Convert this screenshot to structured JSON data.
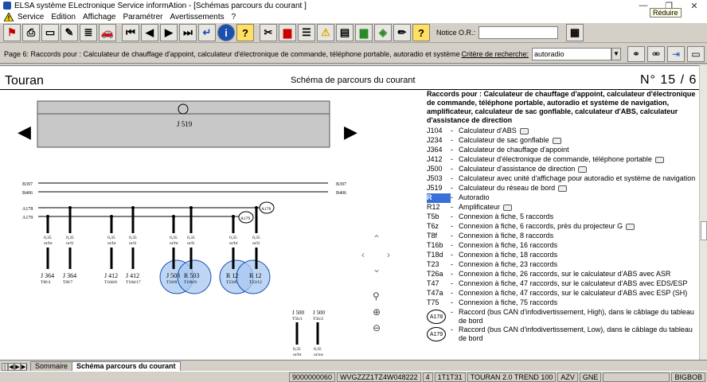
{
  "window": {
    "title": "ELSA système ELectronique Service informAtion - [Schémas parcours du courant ]",
    "tooltip": "Réduire"
  },
  "menu": {
    "items": [
      "Service",
      "Edition",
      "Affichage",
      "Paramétrer",
      "Avertissements",
      "?"
    ]
  },
  "toolbar": {
    "notice_label": "Notice O.R.:",
    "notice_value": ""
  },
  "infobar": {
    "path": "Page 6: Raccords pour : Calculateur de chauffage d'appoint, calculateur d'électronique de commande, téléphone portable, autoradio et système de navigation,",
    "search_label": "Critère de recherche:",
    "search_value": "autoradio"
  },
  "document": {
    "model": "Touran",
    "title": "Schéma de parcours du courant",
    "page": "N°  15 / 6"
  },
  "schematic": {
    "module_label": "J 519",
    "rails": {
      "b397": "B397",
      "b406": "B406",
      "a178": "A178",
      "a179": "A179"
    },
    "wires": [
      {
        "size": "0,35",
        "color": "or/br",
        "comp": "J 364",
        "pin": "T8f/4"
      },
      {
        "size": "0,35",
        "color": "or/li",
        "comp": "J 364",
        "pin": "T8f/7"
      },
      {
        "size": "0,35",
        "color": "or/br",
        "comp": "J 412",
        "pin": "T18d/8"
      },
      {
        "size": "0,35",
        "color": "or/li",
        "comp": "J 412",
        "pin": "T18d/17"
      },
      {
        "size": "0,35",
        "color": "or/br",
        "comp": "J 503",
        "pin": "T18/8"
      },
      {
        "size": "0,35",
        "color": "or/li",
        "comp": "R 503",
        "pin": "T18b/9"
      },
      {
        "size": "0,35",
        "color": "or/br",
        "comp": "R 12",
        "pin": "T23/8"
      },
      {
        "size": "0,35",
        "color": "or/li",
        "comp": "R 12",
        "pin": "T23/12"
      }
    ],
    "lower_wires": [
      {
        "size": "0,35",
        "color": "or/br",
        "comp": "J 500",
        "pin": "T5b/1"
      },
      {
        "size": "0,35",
        "color": "or/sw",
        "comp": "J 500",
        "pin": "T5b/2"
      }
    ]
  },
  "legend": {
    "heading": "Raccords pour : Calculateur de chauffage d'appoint, calculateur d'électronique de commande, téléphone portable, autoradio et système de navigation, amplificateur, calculateur de sac gonflable, calculateur d'ABS, calculateur d'assistance de direction",
    "rows": [
      {
        "code": "J104",
        "desc": "Calculateur d'ABS",
        "cam": true
      },
      {
        "code": "J234",
        "desc": "Calculateur de sac gonflable",
        "cam": true
      },
      {
        "code": "J364",
        "desc": "Calculateur de chauffage d'appoint",
        "cam": false
      },
      {
        "code": "J412",
        "desc": "Calculateur d'électronique de commande, téléphone portable",
        "cam": true
      },
      {
        "code": "J500",
        "desc": "Calculateur d'assistance de direction",
        "cam": true
      },
      {
        "code": "J503",
        "desc": "Calculateur avec unité d'affichage pour autoradio et système de navigation",
        "cam": false
      },
      {
        "code": "J519",
        "desc": "Calculateur du réseau de bord",
        "cam": true
      },
      {
        "code": "R",
        "desc": "Autoradio",
        "cam": false,
        "highlight": true
      },
      {
        "code": "R12",
        "desc": "Amplificateur",
        "cam": true
      },
      {
        "code": "T5b",
        "desc": "Connexion à fiche, 5 raccords",
        "cam": false
      },
      {
        "code": "T6z",
        "desc": "Connexion à fiche, 6 raccords, près du projecteur G",
        "cam": true
      },
      {
        "code": "T8f",
        "desc": "Connexion à fiche, 8 raccords",
        "cam": false
      },
      {
        "code": "T16b",
        "desc": "Connexion à fiche, 16 raccords",
        "cam": false
      },
      {
        "code": "T18d",
        "desc": "Connexion à fiche, 18 raccords",
        "cam": false
      },
      {
        "code": "T23",
        "desc": "Connexion à fiche, 23 raccords",
        "cam": false
      },
      {
        "code": "T26a",
        "desc": "Connexion à fiche, 26 raccords, sur le calculateur d'ABS avec ASR",
        "cam": false
      },
      {
        "code": "T47",
        "desc": "Connexion à fiche, 47 raccords, sur le calculateur d'ABS avec EDS/ESP",
        "cam": false
      },
      {
        "code": "T47a",
        "desc": "Connexion à fiche, 47 raccords, sur le calculateur d'ABS avec ESP (SH)",
        "cam": false
      },
      {
        "code": "T75",
        "desc": "Connexion à fiche, 75 raccords",
        "cam": false
      }
    ],
    "circles": [
      {
        "code": "A178",
        "desc": "Raccord (bus CAN d'infodivertissement, High), dans le câblage du tableau de bord"
      },
      {
        "code": "A179",
        "desc": "Raccord (bus CAN d'infodivertissement, Low), dans le câblage du tableau de bord"
      }
    ]
  },
  "tabs": [
    "Sommaire",
    "Schéma parcours du courant"
  ],
  "status": [
    "9000000060",
    "WVGZZZ1TZ4W048222",
    "4",
    "1T1T31",
    "TOURAN 2.0 TREND 100",
    "AZV",
    "GNE",
    "BIGBOB"
  ]
}
